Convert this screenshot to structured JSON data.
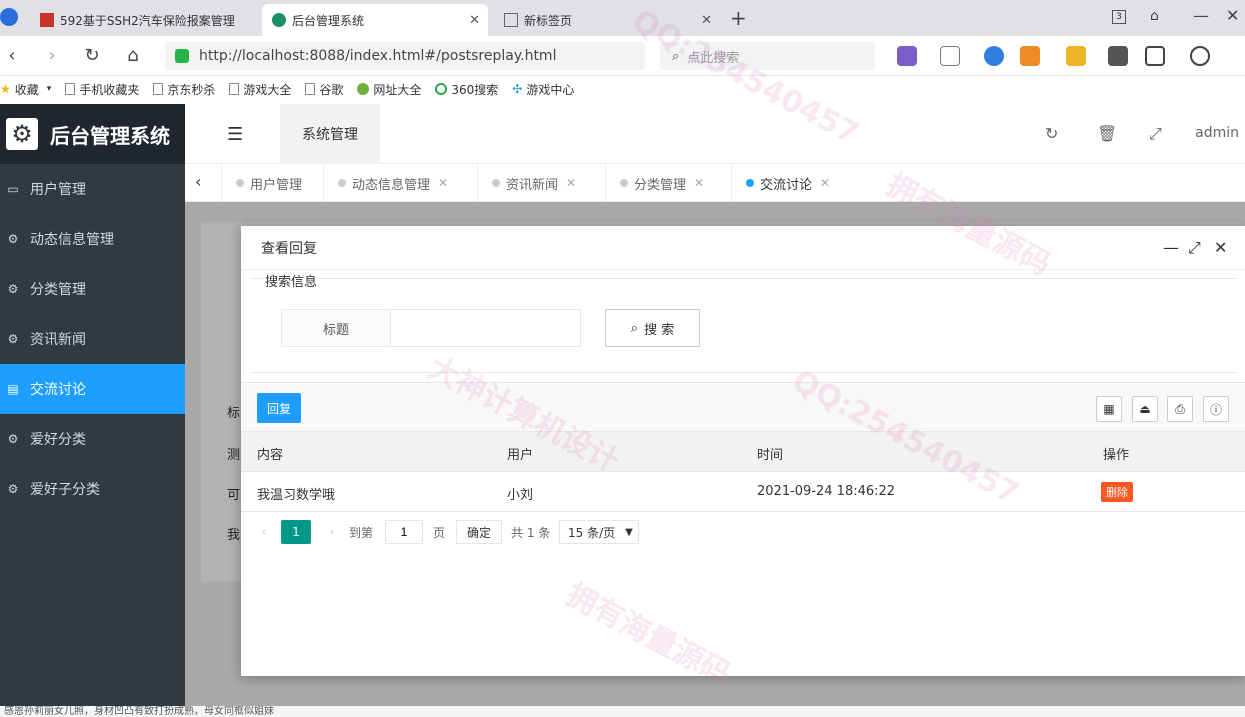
{
  "browser": {
    "tabs": [
      {
        "title": "592基于SSH2汽车保险报案管理"
      },
      {
        "title": "后台管理系统"
      },
      {
        "title": "新标签页"
      }
    ],
    "url": "http://localhost:8088/index.html#/postsreplay.html",
    "search_placeholder": "点此搜索",
    "bookmarks": [
      "收藏",
      "手机收藏夹",
      "京东秒杀",
      "游戏大全",
      "谷歌",
      "网址大全",
      "360搜索",
      "游戏中心"
    ]
  },
  "app": {
    "logo_title": "后台管理系统",
    "header": {
      "module": "系统管理",
      "user": "admin"
    },
    "sidebar": [
      {
        "label": "用户管理"
      },
      {
        "label": "动态信息管理"
      },
      {
        "label": "分类管理"
      },
      {
        "label": "资讯新闻"
      },
      {
        "label": "交流讨论"
      },
      {
        "label": "爱好分类"
      },
      {
        "label": "爱好子分类"
      }
    ],
    "page_tabs": [
      {
        "label": "用户管理"
      },
      {
        "label": "动态信息管理"
      },
      {
        "label": "资讯新闻"
      },
      {
        "label": "分类管理"
      },
      {
        "label": "交流讨论"
      }
    ],
    "background_rows": [
      "标",
      "测",
      "可",
      "我"
    ]
  },
  "modal": {
    "title": "查看回复",
    "search_legend": "搜索信息",
    "field_label": "标题",
    "field_value": "",
    "search_button": "搜 索",
    "reply_button": "回复",
    "columns": [
      "内容",
      "用户",
      "时间",
      "操作"
    ],
    "rows": [
      {
        "content": "我温习数学哦",
        "user": "小刘",
        "time": "2021-09-24 18:46:22",
        "action": "删除"
      }
    ],
    "pager": {
      "current": "1",
      "goto_label": "到第",
      "goto_value": "1",
      "page_unit": "页",
      "confirm": "确定",
      "total": "共 1 条",
      "page_size": "15 条/页"
    }
  },
  "statusbar_text": "感恩孙莉丽女儿照，身材凹凸有致打扮成熟，母女同框似姐妹",
  "watermark": [
    "QQ:254540457",
    "大神计算机设计",
    "拥有海量源码"
  ]
}
